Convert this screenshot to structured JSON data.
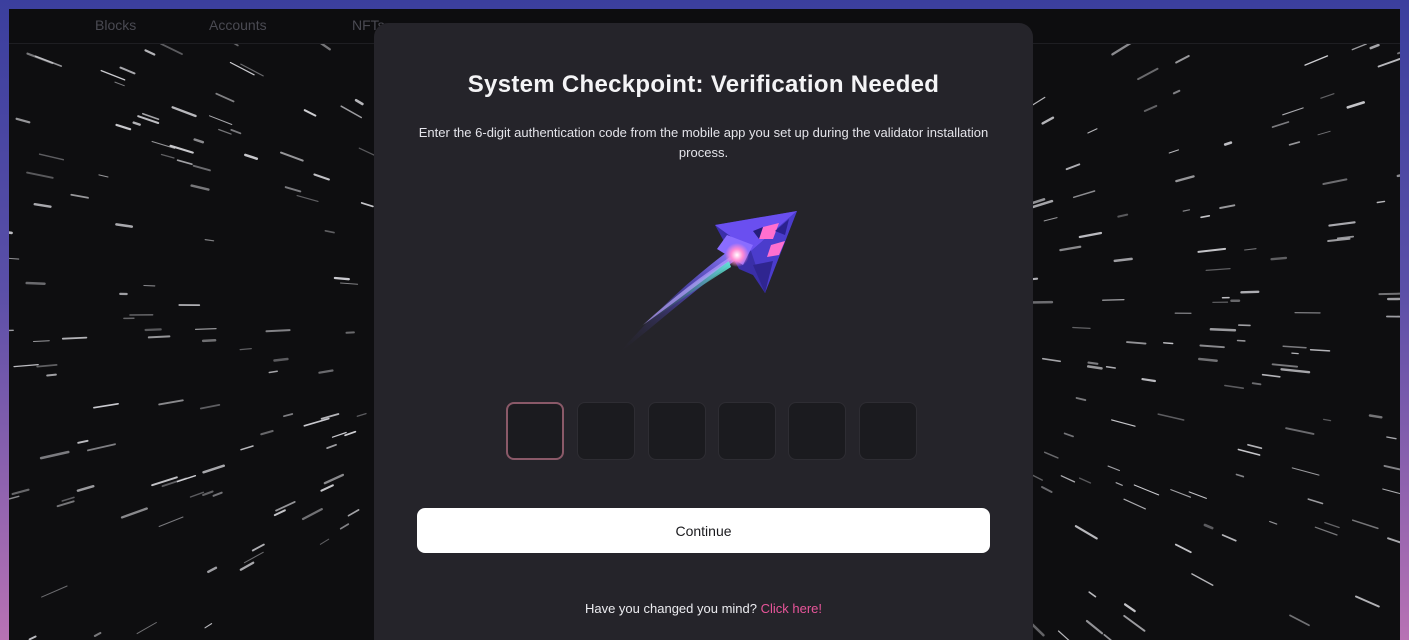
{
  "nav": {
    "items": [
      "Blocks",
      "Accounts",
      "NFTs"
    ]
  },
  "modal": {
    "title": "System Checkpoint: Verification Needed",
    "subtitle": "Enter the 6-digit authentication code from the mobile app you set up during the validator installation process.",
    "code_digits": [
      "",
      "",
      "",
      "",
      "",
      ""
    ],
    "continue_label": "Continue",
    "footer_question": "Have you changed you mind?",
    "footer_link": "Click here!",
    "hero_icon": "rocket-icon"
  },
  "colors": {
    "accent_link": "#e8559a",
    "modal_bg": "#25242a",
    "page_bg": "#0e0e10",
    "active_border": "#8a5968"
  }
}
